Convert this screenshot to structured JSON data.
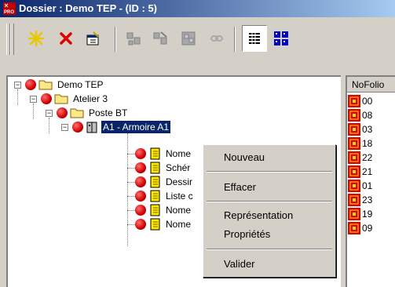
{
  "window": {
    "title": "Dossier : Demo TEP - (ID : 5)",
    "app_icon_text": "PRO"
  },
  "toolbar": {
    "buttons": [
      {
        "name": "new-icon",
        "enabled": true
      },
      {
        "name": "delete-icon",
        "enabled": true
      },
      {
        "name": "properties-icon",
        "enabled": true
      },
      {
        "name": "tool-a-icon",
        "enabled": false
      },
      {
        "name": "tool-b-icon",
        "enabled": false
      },
      {
        "name": "tool-c-icon",
        "enabled": false
      },
      {
        "name": "link-icon",
        "enabled": false
      },
      {
        "name": "list-view-icon",
        "enabled": true
      },
      {
        "name": "grid-view-icon",
        "enabled": true
      }
    ]
  },
  "tree": {
    "nodes": [
      {
        "label": "Demo TEP",
        "icon": "folder"
      },
      {
        "label": "Atelier 3",
        "icon": "folder"
      },
      {
        "label": "Poste BT",
        "icon": "folder"
      },
      {
        "label": "A1 - Armoire A1",
        "icon": "cabinet",
        "selected": true
      },
      {
        "label": "Nome",
        "icon": "document"
      },
      {
        "label": "Schér",
        "icon": "document"
      },
      {
        "label": "Dessir",
        "icon": "document"
      },
      {
        "label": "Liste c",
        "icon": "document"
      },
      {
        "label": "Nome",
        "icon": "document"
      },
      {
        "label": "Nome",
        "icon": "document"
      }
    ]
  },
  "table": {
    "header": "NoFolio",
    "rows": [
      "00",
      "08",
      "03",
      "18",
      "22",
      "21",
      "01",
      "23",
      "19",
      "09"
    ]
  },
  "context_menu": {
    "nouveau": "Nouveau",
    "effacer": "Effacer",
    "representation": "Représentation",
    "proprietes": "Propriétés",
    "valider": "Valider"
  }
}
